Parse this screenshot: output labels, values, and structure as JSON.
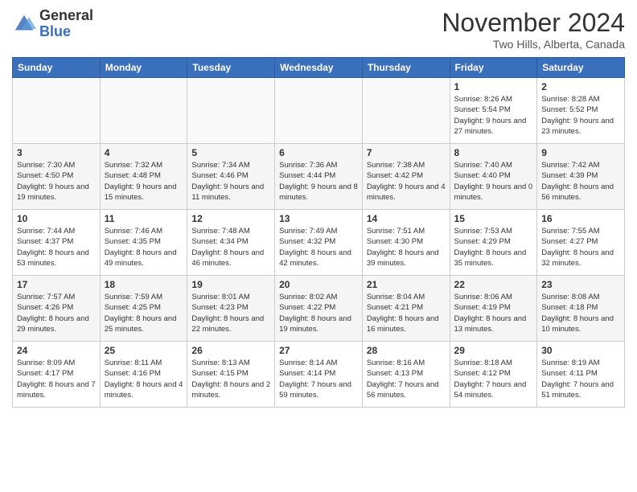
{
  "header": {
    "logo_line1": "General",
    "logo_line2": "Blue",
    "month_title": "November 2024",
    "location": "Two Hills, Alberta, Canada"
  },
  "weekdays": [
    "Sunday",
    "Monday",
    "Tuesday",
    "Wednesday",
    "Thursday",
    "Friday",
    "Saturday"
  ],
  "weeks": [
    [
      {
        "day": "",
        "info": ""
      },
      {
        "day": "",
        "info": ""
      },
      {
        "day": "",
        "info": ""
      },
      {
        "day": "",
        "info": ""
      },
      {
        "day": "",
        "info": ""
      },
      {
        "day": "1",
        "info": "Sunrise: 8:26 AM\nSunset: 5:54 PM\nDaylight: 9 hours and 27 minutes."
      },
      {
        "day": "2",
        "info": "Sunrise: 8:28 AM\nSunset: 5:52 PM\nDaylight: 9 hours and 23 minutes."
      }
    ],
    [
      {
        "day": "3",
        "info": "Sunrise: 7:30 AM\nSunset: 4:50 PM\nDaylight: 9 hours and 19 minutes."
      },
      {
        "day": "4",
        "info": "Sunrise: 7:32 AM\nSunset: 4:48 PM\nDaylight: 9 hours and 15 minutes."
      },
      {
        "day": "5",
        "info": "Sunrise: 7:34 AM\nSunset: 4:46 PM\nDaylight: 9 hours and 11 minutes."
      },
      {
        "day": "6",
        "info": "Sunrise: 7:36 AM\nSunset: 4:44 PM\nDaylight: 9 hours and 8 minutes."
      },
      {
        "day": "7",
        "info": "Sunrise: 7:38 AM\nSunset: 4:42 PM\nDaylight: 9 hours and 4 minutes."
      },
      {
        "day": "8",
        "info": "Sunrise: 7:40 AM\nSunset: 4:40 PM\nDaylight: 9 hours and 0 minutes."
      },
      {
        "day": "9",
        "info": "Sunrise: 7:42 AM\nSunset: 4:39 PM\nDaylight: 8 hours and 56 minutes."
      }
    ],
    [
      {
        "day": "10",
        "info": "Sunrise: 7:44 AM\nSunset: 4:37 PM\nDaylight: 8 hours and 53 minutes."
      },
      {
        "day": "11",
        "info": "Sunrise: 7:46 AM\nSunset: 4:35 PM\nDaylight: 8 hours and 49 minutes."
      },
      {
        "day": "12",
        "info": "Sunrise: 7:48 AM\nSunset: 4:34 PM\nDaylight: 8 hours and 46 minutes."
      },
      {
        "day": "13",
        "info": "Sunrise: 7:49 AM\nSunset: 4:32 PM\nDaylight: 8 hours and 42 minutes."
      },
      {
        "day": "14",
        "info": "Sunrise: 7:51 AM\nSunset: 4:30 PM\nDaylight: 8 hours and 39 minutes."
      },
      {
        "day": "15",
        "info": "Sunrise: 7:53 AM\nSunset: 4:29 PM\nDaylight: 8 hours and 35 minutes."
      },
      {
        "day": "16",
        "info": "Sunrise: 7:55 AM\nSunset: 4:27 PM\nDaylight: 8 hours and 32 minutes."
      }
    ],
    [
      {
        "day": "17",
        "info": "Sunrise: 7:57 AM\nSunset: 4:26 PM\nDaylight: 8 hours and 29 minutes."
      },
      {
        "day": "18",
        "info": "Sunrise: 7:59 AM\nSunset: 4:25 PM\nDaylight: 8 hours and 25 minutes."
      },
      {
        "day": "19",
        "info": "Sunrise: 8:01 AM\nSunset: 4:23 PM\nDaylight: 8 hours and 22 minutes."
      },
      {
        "day": "20",
        "info": "Sunrise: 8:02 AM\nSunset: 4:22 PM\nDaylight: 8 hours and 19 minutes."
      },
      {
        "day": "21",
        "info": "Sunrise: 8:04 AM\nSunset: 4:21 PM\nDaylight: 8 hours and 16 minutes."
      },
      {
        "day": "22",
        "info": "Sunrise: 8:06 AM\nSunset: 4:19 PM\nDaylight: 8 hours and 13 minutes."
      },
      {
        "day": "23",
        "info": "Sunrise: 8:08 AM\nSunset: 4:18 PM\nDaylight: 8 hours and 10 minutes."
      }
    ],
    [
      {
        "day": "24",
        "info": "Sunrise: 8:09 AM\nSunset: 4:17 PM\nDaylight: 8 hours and 7 minutes."
      },
      {
        "day": "25",
        "info": "Sunrise: 8:11 AM\nSunset: 4:16 PM\nDaylight: 8 hours and 4 minutes."
      },
      {
        "day": "26",
        "info": "Sunrise: 8:13 AM\nSunset: 4:15 PM\nDaylight: 8 hours and 2 minutes."
      },
      {
        "day": "27",
        "info": "Sunrise: 8:14 AM\nSunset: 4:14 PM\nDaylight: 7 hours and 59 minutes."
      },
      {
        "day": "28",
        "info": "Sunrise: 8:16 AM\nSunset: 4:13 PM\nDaylight: 7 hours and 56 minutes."
      },
      {
        "day": "29",
        "info": "Sunrise: 8:18 AM\nSunset: 4:12 PM\nDaylight: 7 hours and 54 minutes."
      },
      {
        "day": "30",
        "info": "Sunrise: 8:19 AM\nSunset: 4:11 PM\nDaylight: 7 hours and 51 minutes."
      }
    ]
  ]
}
